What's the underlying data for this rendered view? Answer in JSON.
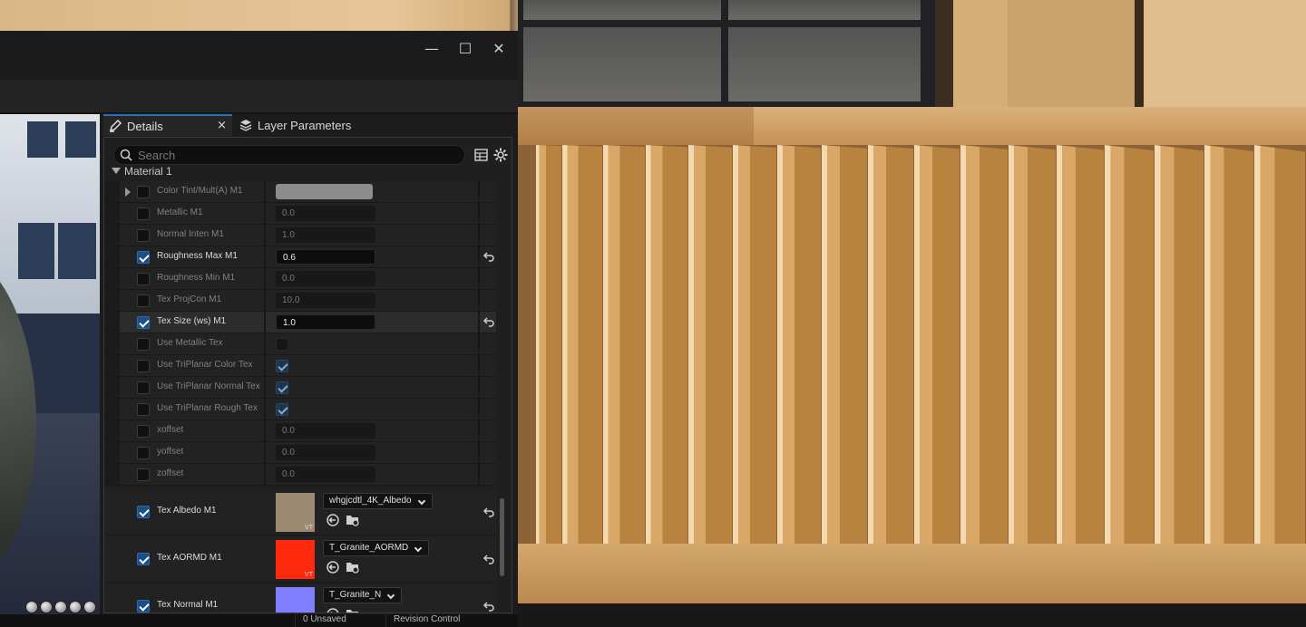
{
  "window": {
    "minimize_glyph": "—",
    "maximize_glyph": "☐",
    "close_glyph": "✕"
  },
  "tabs": {
    "details": "Details",
    "layer_parameters": "Layer Parameters",
    "close_glyph": "×"
  },
  "search": {
    "placeholder": "Search"
  },
  "section": {
    "label": "Material 1"
  },
  "params": [
    {
      "label": "Color Tint/Mult(A) M1",
      "kind": "color",
      "checked": false,
      "active": false,
      "swatch": "#8d8d8d"
    },
    {
      "label": "Metallic M1",
      "kind": "value",
      "value": "0.0",
      "checked": false,
      "active": false
    },
    {
      "label": "Normal Inten M1",
      "kind": "value",
      "value": "1.0",
      "checked": false,
      "active": false
    },
    {
      "label": "Roughness Max M1",
      "kind": "value",
      "value": "0.6",
      "checked": true,
      "active": true
    },
    {
      "label": "Roughness Min M1",
      "kind": "value",
      "value": "0.0",
      "checked": false,
      "active": false
    },
    {
      "label": "Tex ProjCon M1",
      "kind": "value",
      "value": "10.0",
      "checked": false,
      "active": false
    },
    {
      "label": "Tex Size (ws) M1",
      "kind": "value",
      "value": "1.0",
      "checked": true,
      "active": true
    },
    {
      "label": "Use Metallic Tex",
      "kind": "bool",
      "value_checked": false,
      "checked": false,
      "active": false
    },
    {
      "label": "Use TriPlanar Color Tex",
      "kind": "bool",
      "value_checked": true,
      "checked": false,
      "active": false
    },
    {
      "label": "Use TriPlanar Normal Tex",
      "kind": "bool",
      "value_checked": true,
      "checked": false,
      "active": false
    },
    {
      "label": "Use TriPlanar Rough Tex",
      "kind": "bool",
      "value_checked": true,
      "checked": false,
      "active": false
    },
    {
      "label": "xoffset",
      "kind": "value",
      "value": "0.0",
      "checked": false,
      "active": false
    },
    {
      "label": "yoffset",
      "kind": "value",
      "value": "0.0",
      "checked": false,
      "active": false
    },
    {
      "label": "zoffset",
      "kind": "value",
      "value": "0.0",
      "checked": false,
      "active": false
    }
  ],
  "textures": [
    {
      "label": "Tex Albedo M1",
      "asset": "whgjcdtl_4K_Albedo",
      "thumb_color": "#9d8a73",
      "badge": "VT"
    },
    {
      "label": "Tex AORMD M1",
      "asset": "T_Granite_AORMD",
      "thumb_color": "#ff2a0d",
      "badge": "VT"
    },
    {
      "label": "Tex Normal M1",
      "asset": "T_Granite_N",
      "thumb_color": "#7f7fff",
      "badge": ""
    }
  ],
  "status": {
    "item1": "0 Unsaved",
    "item2": "Revision Control"
  },
  "colors": {
    "accent": "#2f6fb8",
    "checkbox_on": "#1a4f86",
    "panel_bg": "#1f1f1f"
  }
}
